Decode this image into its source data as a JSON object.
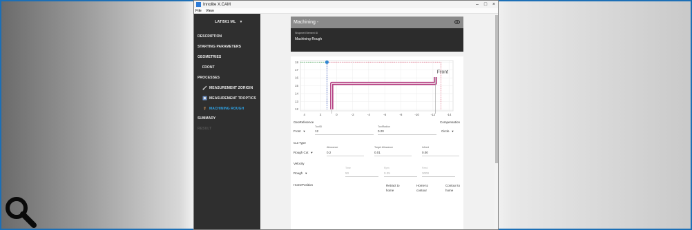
{
  "window": {
    "title": "Innolite X.CAM",
    "menu": [
      "File",
      "View"
    ]
  },
  "sidebar": {
    "machine": "LATI501 ML",
    "items": [
      {
        "label": "DESCRIPTION"
      },
      {
        "label": "STARTING PARAMETERS"
      },
      {
        "label": "GEOMETRIES"
      },
      {
        "label": "FRONT"
      },
      {
        "label": "PROCESSES"
      },
      {
        "label": "MEASUREMENT ZORIGIN"
      },
      {
        "label": "MEASUREMENT TROPTICS"
      },
      {
        "label": "MACHINING ROUGH"
      },
      {
        "label": "SUMMARY"
      },
      {
        "label": "RESULT"
      }
    ]
  },
  "panel": {
    "header": "Machining -",
    "element_id_label": "Shopmet Element ID",
    "element_id_value": "Machining-Rough"
  },
  "chart_data": {
    "type": "line",
    "annotation": "Front",
    "x_ticks": [
      "4",
      "2",
      "0",
      "-2",
      "-4",
      "-6",
      "-8",
      "-10",
      "-12",
      "-14"
    ],
    "y_ticks": [
      "18",
      "17",
      "16",
      "15",
      "14",
      "13",
      "12"
    ],
    "xlim": [
      4.5,
      -14.5
    ],
    "ylim": [
      11.8,
      18.2
    ],
    "series": [
      {
        "points": [
          [
            0.6,
            12.0
          ],
          [
            0.6,
            15.3
          ],
          [
            -12.3,
            15.3
          ],
          [
            -12.3,
            16.1
          ]
        ],
        "color": "#b1367c"
      },
      {
        "points": [
          [
            1.2,
            18.0
          ],
          [
            -13.0,
            18.0
          ],
          [
            -13.0,
            12.0
          ]
        ],
        "color": "#e06b84"
      },
      {
        "points": [
          [
            1.2,
            18.0
          ],
          [
            1.2,
            12.0
          ]
        ],
        "color": "#2a4bb3"
      },
      {
        "points": [
          [
            4.5,
            18.0
          ],
          [
            1.2,
            18.0
          ]
        ],
        "color": "#3b9e4b"
      }
    ],
    "marker": {
      "x": 1.2,
      "y": 18.0,
      "color": "#2f86d1"
    },
    "grid": true
  },
  "form": {
    "geo_reference_label": "GeoReference",
    "geo_reference_value": "Front",
    "tool_id_label": "ToolID",
    "tool_id_value": "12",
    "tool_radius_label": "ToolRadius",
    "tool_radius_value": "0.20",
    "compensation_label": "Compensation",
    "compensation_value": "Circle",
    "cut_type_label": "Cut Type",
    "cut_type_value": "Rough Cut",
    "allowance_label": "Allowance",
    "allowance_value": "0.2",
    "target_allowance_label": "Target Allowance",
    "target_allowance_value": "0.01",
    "infeed_label": "Infeed",
    "infeed_value": "0.00",
    "velocity_label": "Velocity",
    "velocity_value": "Rough",
    "time_label": "Time",
    "time_value": "50",
    "rpm_label": "Rpm",
    "rpm_value": "0.25",
    "feed_label": "Feed",
    "feed_value": "3000",
    "home_position_label": "HomePosition",
    "retract_label": "Retract to home",
    "home_to_contour_label": "Home to contour",
    "contour_to_home_label": "Contour to home"
  }
}
